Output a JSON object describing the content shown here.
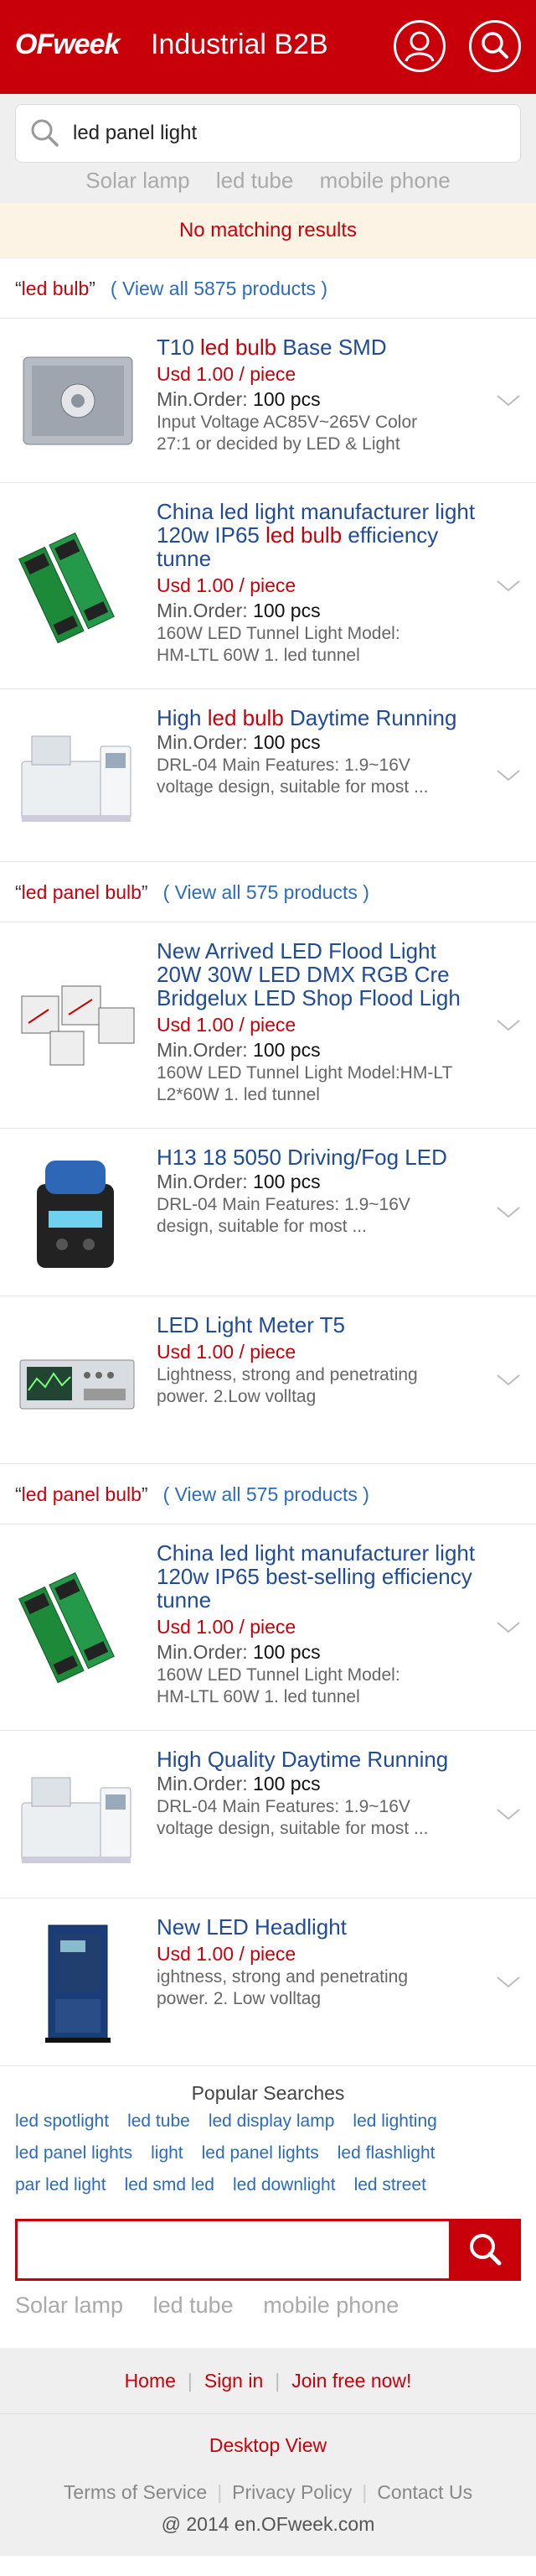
{
  "header": {
    "logo": "OFweek",
    "title": "Industrial B2B",
    "user_icon": "user-icon",
    "search_icon": "search-icon",
    "brand_color": "#c8000a"
  },
  "search": {
    "value": "led panel light",
    "hints": [
      "Solar lamp",
      "led tube",
      "mobile phone"
    ]
  },
  "notice": "No matching results",
  "sections": [
    {
      "keyword": "led bulb",
      "view_all": "( View all 5875 products )",
      "items": [
        {
          "title": [
            "T10 ",
            "led bulb",
            " Base SMD"
          ],
          "price": "Usd 1.00 / piece",
          "min_label": "Min.Order:",
          "min_value": "100 pcs",
          "desc": [
            "Input Voltage  AC85V~265V Color",
            "27:1 or decided by LED & Light"
          ]
        },
        {
          "title": [
            "China led light manufacturer light 120w IP65 ",
            "led bulb",
            " efficiency tunne"
          ],
          "price": "Usd 1.00 / piece",
          "min_label": "Min.Order:",
          "min_value": "100 pcs",
          "desc": [
            "160W LED Tunnel Light Model:",
            "HM-LTL 60W 1. led tunnel"
          ]
        },
        {
          "title": [
            "High ",
            "led bulb",
            " Daytime Running"
          ],
          "price": "",
          "min_label": "Min.Order:",
          "min_value": "100 pcs",
          "desc": [
            "DRL-04 Main Features: 1.9~16V",
            "voltage design, suitable for most ..."
          ]
        }
      ]
    },
    {
      "keyword": "led panel bulb",
      "view_all": "( View all 575 products )",
      "items": [
        {
          "title": [
            "New Arrived LED Flood Light 20W 30W LED DMX RGB Cre Bridgelux LED Shop Flood Ligh",
            "",
            ""
          ],
          "price": "Usd 1.00 / piece",
          "min_label": "Min.Order:",
          "min_value": "100 pcs",
          "desc": [
            "160W LED Tunnel Light Model:HM-LT",
            "L2*60W 1. led tunnel"
          ]
        },
        {
          "title": [
            "H13 18 5050 Driving/Fog LED",
            "",
            ""
          ],
          "price": "",
          "min_label": "Min.Order:",
          "min_value": "100 pcs",
          "desc": [
            "DRL-04 Main Features: 1.9~16V",
            "design, suitable for most ..."
          ]
        },
        {
          "title": [
            "LED Light Meter T5",
            "",
            ""
          ],
          "price": "Usd 1.00 / piece",
          "min_label": "",
          "min_value": "",
          "desc": [
            "Lightness, strong and penetrating",
            "power. 2.Low volltag"
          ]
        }
      ]
    },
    {
      "keyword": "led panel bulb",
      "view_all": "( View all 575 products )",
      "items": [
        {
          "title": [
            "China led light manufacturer light 120w IP65 best-selling efficiency tunne",
            "",
            ""
          ],
          "price": "Usd 1.00 / piece",
          "min_label": "Min.Order:",
          "min_value": "100 pcs",
          "desc": [
            "160W LED Tunnel Light Model:",
            "HM-LTL 60W 1. led tunnel"
          ]
        },
        {
          "title": [
            "High Quality Daytime Running",
            "",
            ""
          ],
          "price": "",
          "min_label": "Min.Order:",
          "min_value": "100 pcs",
          "desc": [
            "DRL-04 Main Features: 1.9~16V",
            "voltage design, suitable for most ..."
          ]
        },
        {
          "title": [
            "New LED Headlight",
            "",
            ""
          ],
          "price": "Usd 1.00 / piece",
          "min_label": "",
          "min_value": "",
          "desc": [
            "ightness, strong and penetrating",
            "power. 2. Low volltag"
          ]
        }
      ]
    }
  ],
  "popular": {
    "title": "Popular Searches",
    "links": [
      "led spotlight",
      "led tube",
      "led display lamp",
      "led lighting",
      "led panel lights",
      "light",
      "led panel lights",
      "led flashlight",
      "par led light",
      "led smd led",
      "led downlight",
      "led street"
    ]
  },
  "bottom_search": {
    "value": "",
    "hints": [
      "Solar lamp",
      "led tube",
      "mobile phone"
    ]
  },
  "footer": {
    "nav": [
      "Home",
      "Sign in",
      "Join free now!"
    ],
    "desktop": "Desktop View",
    "links": [
      "Terms of Service",
      "Privacy Policy",
      "Contact Us"
    ],
    "copyright": "@ 2014 en.OFweek.com"
  }
}
